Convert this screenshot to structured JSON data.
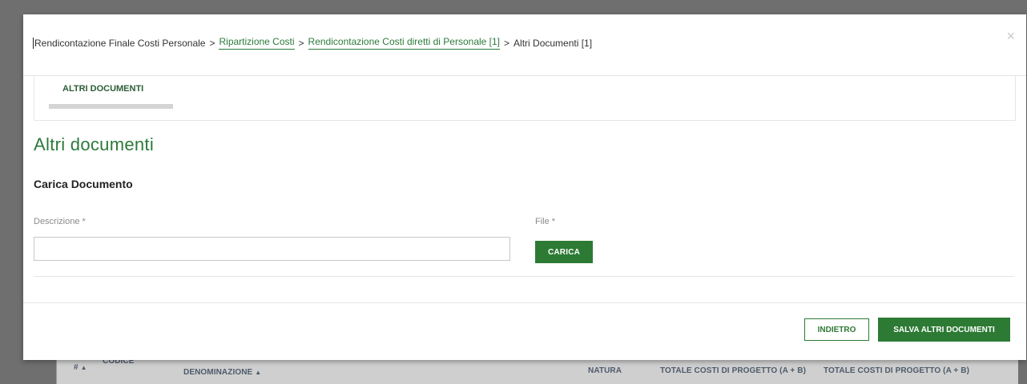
{
  "breadcrumb": {
    "root": "Rendicontazione Finale Costi Personale",
    "link1": "Ripartizione Costi",
    "link2": "Rendicontazione Costi diretti di Personale [1]",
    "current": "Altri Documenti [1]",
    "separator": ">"
  },
  "close_label": "×",
  "tabs": [
    {
      "label": "ALTRI DOCUMENTI"
    }
  ],
  "page_title": "Altri documenti",
  "section_title": "Carica Documento",
  "form": {
    "description_label": "Descrizione *",
    "description_value": "",
    "file_label": "File *",
    "upload_button": "CARICA"
  },
  "footer": {
    "back_button": "INDIETRO",
    "save_button": "SALVA ALTRI DOCUMENTI"
  },
  "background_table": {
    "col_hash": "#",
    "col_codice": "CODICE",
    "col_denominazione": "DENOMINAZIONE",
    "col_natura": "NATURA",
    "col_totale1": "TOTALE COSTI DI PROGETTO (A + B)",
    "col_totale2": "TOTALE COSTI DI PROGETTO (A + B)"
  },
  "colors": {
    "accent": "#2d7a35",
    "overlay": "#6f6f6f"
  }
}
